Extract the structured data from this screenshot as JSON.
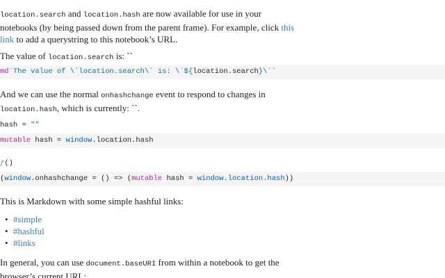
{
  "para1": {
    "code1": "location.search",
    "t1": " and ",
    "code2": "location.hash",
    "t2": " are now available for use in your notebooks (by being passed down from the parent frame). For example, click ",
    "link": "this link",
    "t3": " to add a querystring to this notebook’s URL."
  },
  "para2": {
    "t1": "The value of ",
    "code": "location.search",
    "t2": " is: ``"
  },
  "cell1": {
    "kw": "md",
    "str1": "`The value of \\`location.search\\` is: \\`${",
    "expr1": "location",
    "expr2": ".search",
    "str2": "}\\``"
  },
  "para3": {
    "t1": "And we can use the normal ",
    "code1": "onhashchange",
    "t2": " event to respond to changes in ",
    "code2": "location.hash",
    "t3": ", which is currently: ``."
  },
  "cell2": {
    "name": "hash",
    "op": " = ",
    "val": "\"\""
  },
  "cell3": {
    "kw": "mutable",
    "t1": " hash = ",
    "g": "window",
    "t2": ".location.hash"
  },
  "cell4": {
    "fn": "ƒ",
    "t1": "()"
  },
  "cell5": {
    "t1": "(",
    "g1": "window",
    "t2": ".onhashchange = () => (",
    "kw": "mutable",
    "t3": " hash = ",
    "g2": "window",
    "t4": ".location.hash",
    "t5": "))"
  },
  "para4": {
    "text": "This is Markdown with some simple hashful links:"
  },
  "links": [
    "#simple",
    "#hashful",
    "#links"
  ],
  "bullet": "•",
  "para5": {
    "t1": "In general, you can use ",
    "code": "document.baseURI",
    "t2": " from within a notebook to get the browser’s current URL:"
  }
}
